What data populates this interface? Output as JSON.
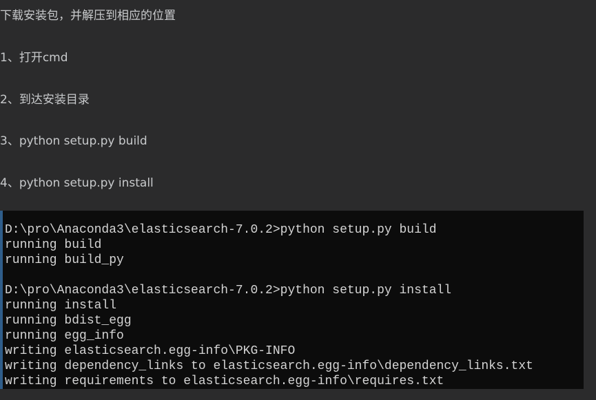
{
  "article": {
    "paragraphs": [
      "下载安装包，并解压到相应的位置",
      "1、打开cmd",
      "2、到达安装目录",
      "3、python setup.py build",
      "4、python setup.py install"
    ]
  },
  "terminal": {
    "lines": [
      "D:\\pro\\Anaconda3\\elasticsearch-7.0.2>python setup.py build",
      "running build",
      "running build_py",
      "",
      "D:\\pro\\Anaconda3\\elasticsearch-7.0.2>python setup.py install",
      "running install",
      "running bdist_egg",
      "running egg_info",
      "writing elasticsearch.egg-info\\PKG-INFO",
      "writing dependency_links to elasticsearch.egg-info\\dependency_links.txt",
      "writing requirements to elasticsearch.egg-info\\requires.txt"
    ]
  },
  "colors": {
    "page_background": "#2b2b2c",
    "text": "#c8cacc",
    "terminal_background": "#0c0c0c",
    "terminal_text": "#d4d4d4"
  }
}
